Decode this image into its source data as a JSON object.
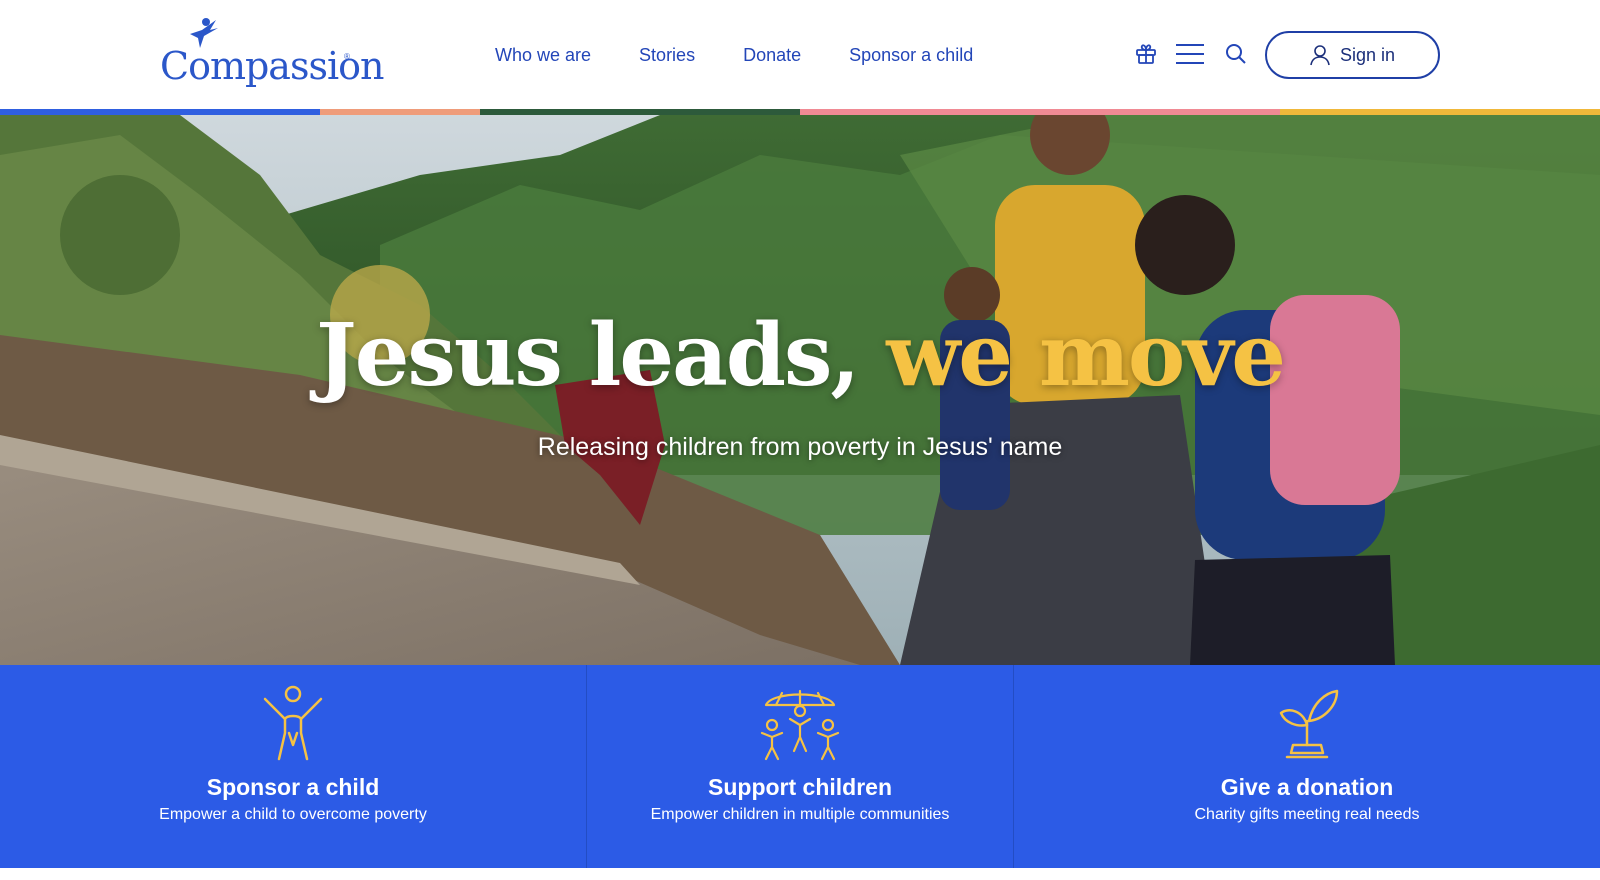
{
  "header": {
    "logo_text": "Compassion",
    "logo_mark": "®",
    "nav": [
      {
        "label": "Who we are"
      },
      {
        "label": "Stories"
      },
      {
        "label": "Donate"
      },
      {
        "label": "Sponsor a child"
      }
    ],
    "icons": [
      "gift-icon",
      "menu-icon",
      "search-icon"
    ],
    "signin_label": "Sign in"
  },
  "stripe_colors": [
    "#2f5fe0",
    "#ef9c7a",
    "#2d5a3b",
    "#f08a94",
    "#f0b83a"
  ],
  "hero": {
    "title_main": "Jesus leads, ",
    "title_accent": "we move",
    "subtitle": "Releasing children from poverty in Jesus' name",
    "accent_color": "#f5c244"
  },
  "cards": [
    {
      "title": "Sponsor a child",
      "subtitle": "Empower a child to overcome poverty",
      "icon": "child-icon"
    },
    {
      "title": "Support children",
      "subtitle": "Empower children in multiple communities",
      "icon": "children-group-icon"
    },
    {
      "title": "Give a donation",
      "subtitle": "Charity gifts meeting real needs",
      "icon": "plant-icon"
    }
  ],
  "colors": {
    "brand_blue": "#2c5be6",
    "nav_blue": "#2346b8",
    "accent_yellow": "#f5c244"
  }
}
